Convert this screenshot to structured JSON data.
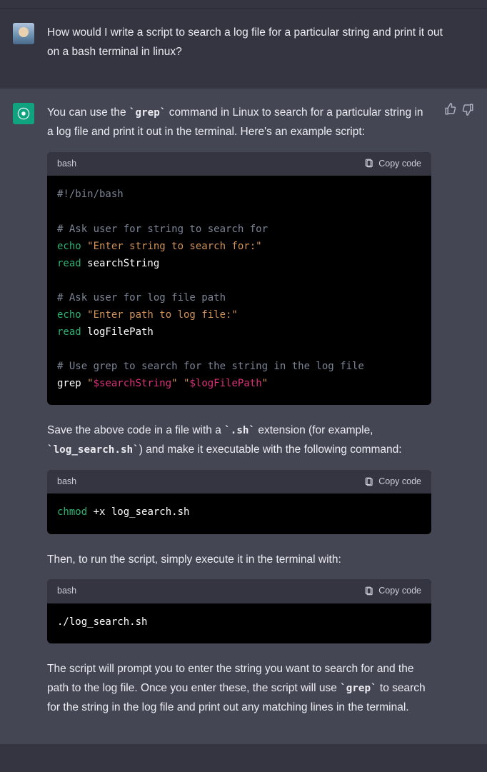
{
  "user": {
    "question": "How would I write a script to search a log file for a particular string and print it out on a bash terminal in linux?"
  },
  "assistant": {
    "intro_pre": "You can use the ",
    "intro_code": "`grep`",
    "intro_post": " command in Linux to search for a particular string in a log file and print it out in the terminal. Here's an example script:",
    "code1": {
      "lang": "bash",
      "copy": "Copy code",
      "l1": "#!/bin/bash",
      "l2c": "# Ask user for string to search for",
      "l3b": "echo",
      "l3s": " \"Enter string to search for:\"",
      "l4b": "read",
      "l4t": " searchString",
      "l5c": "# Ask user for log file path",
      "l6b": "echo",
      "l6s": " \"Enter path to log file:\"",
      "l7b": "read",
      "l7t": " logFilePath",
      "l8c": "# Use grep to search for the string in the log file",
      "l9t1": "grep ",
      "l9q1": "\"",
      "l9v1": "$searchString",
      "l9q2": "\"",
      "l9sp": " ",
      "l9q3": "\"",
      "l9v2": "$logFilePath",
      "l9q4": "\""
    },
    "save_pre": "Save the above code in a file with a ",
    "save_ext": "`.sh`",
    "save_mid": " extension (for example, ",
    "save_fname": "`log_search.sh`",
    "save_post": ") and make it executable with the following command:",
    "code2": {
      "lang": "bash",
      "copy": "Copy code",
      "l1b": "chmod",
      "l1t": " +x log_search.sh"
    },
    "run_text": "Then, to run the script, simply execute it in the terminal with:",
    "code3": {
      "lang": "bash",
      "copy": "Copy code",
      "l1": "./log_search.sh"
    },
    "explain_pre": "The script will prompt you to enter the string you want to search for and the path to the log file. Once you enter these, the script will use ",
    "explain_code": "`grep`",
    "explain_post": " to search for the string in the log file and print out any matching lines in the terminal."
  }
}
